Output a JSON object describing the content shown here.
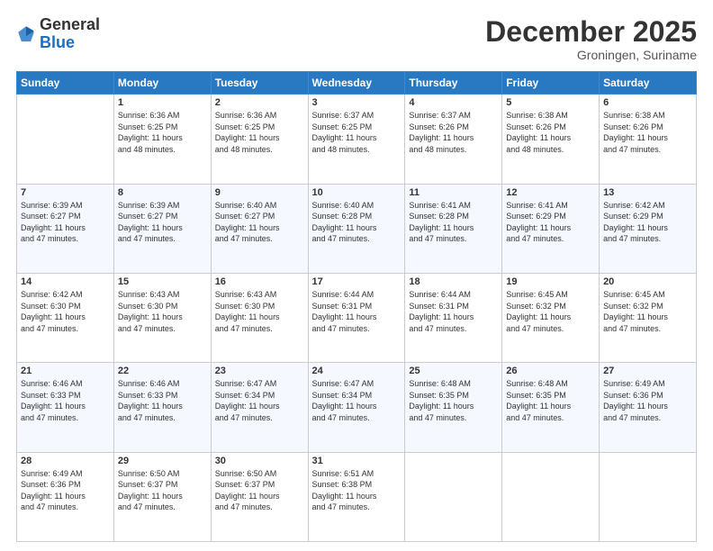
{
  "header": {
    "logo_general": "General",
    "logo_blue": "Blue",
    "month": "December 2025",
    "location": "Groningen, Suriname"
  },
  "weekdays": [
    "Sunday",
    "Monday",
    "Tuesday",
    "Wednesday",
    "Thursday",
    "Friday",
    "Saturday"
  ],
  "weeks": [
    [
      {
        "day": "",
        "info": ""
      },
      {
        "day": "1",
        "info": "Sunrise: 6:36 AM\nSunset: 6:25 PM\nDaylight: 11 hours\nand 48 minutes."
      },
      {
        "day": "2",
        "info": "Sunrise: 6:36 AM\nSunset: 6:25 PM\nDaylight: 11 hours\nand 48 minutes."
      },
      {
        "day": "3",
        "info": "Sunrise: 6:37 AM\nSunset: 6:25 PM\nDaylight: 11 hours\nand 48 minutes."
      },
      {
        "day": "4",
        "info": "Sunrise: 6:37 AM\nSunset: 6:26 PM\nDaylight: 11 hours\nand 48 minutes."
      },
      {
        "day": "5",
        "info": "Sunrise: 6:38 AM\nSunset: 6:26 PM\nDaylight: 11 hours\nand 48 minutes."
      },
      {
        "day": "6",
        "info": "Sunrise: 6:38 AM\nSunset: 6:26 PM\nDaylight: 11 hours\nand 47 minutes."
      }
    ],
    [
      {
        "day": "7",
        "info": "Sunrise: 6:39 AM\nSunset: 6:27 PM\nDaylight: 11 hours\nand 47 minutes."
      },
      {
        "day": "8",
        "info": "Sunrise: 6:39 AM\nSunset: 6:27 PM\nDaylight: 11 hours\nand 47 minutes."
      },
      {
        "day": "9",
        "info": "Sunrise: 6:40 AM\nSunset: 6:27 PM\nDaylight: 11 hours\nand 47 minutes."
      },
      {
        "day": "10",
        "info": "Sunrise: 6:40 AM\nSunset: 6:28 PM\nDaylight: 11 hours\nand 47 minutes."
      },
      {
        "day": "11",
        "info": "Sunrise: 6:41 AM\nSunset: 6:28 PM\nDaylight: 11 hours\nand 47 minutes."
      },
      {
        "day": "12",
        "info": "Sunrise: 6:41 AM\nSunset: 6:29 PM\nDaylight: 11 hours\nand 47 minutes."
      },
      {
        "day": "13",
        "info": "Sunrise: 6:42 AM\nSunset: 6:29 PM\nDaylight: 11 hours\nand 47 minutes."
      }
    ],
    [
      {
        "day": "14",
        "info": "Sunrise: 6:42 AM\nSunset: 6:30 PM\nDaylight: 11 hours\nand 47 minutes."
      },
      {
        "day": "15",
        "info": "Sunrise: 6:43 AM\nSunset: 6:30 PM\nDaylight: 11 hours\nand 47 minutes."
      },
      {
        "day": "16",
        "info": "Sunrise: 6:43 AM\nSunset: 6:30 PM\nDaylight: 11 hours\nand 47 minutes."
      },
      {
        "day": "17",
        "info": "Sunrise: 6:44 AM\nSunset: 6:31 PM\nDaylight: 11 hours\nand 47 minutes."
      },
      {
        "day": "18",
        "info": "Sunrise: 6:44 AM\nSunset: 6:31 PM\nDaylight: 11 hours\nand 47 minutes."
      },
      {
        "day": "19",
        "info": "Sunrise: 6:45 AM\nSunset: 6:32 PM\nDaylight: 11 hours\nand 47 minutes."
      },
      {
        "day": "20",
        "info": "Sunrise: 6:45 AM\nSunset: 6:32 PM\nDaylight: 11 hours\nand 47 minutes."
      }
    ],
    [
      {
        "day": "21",
        "info": "Sunrise: 6:46 AM\nSunset: 6:33 PM\nDaylight: 11 hours\nand 47 minutes."
      },
      {
        "day": "22",
        "info": "Sunrise: 6:46 AM\nSunset: 6:33 PM\nDaylight: 11 hours\nand 47 minutes."
      },
      {
        "day": "23",
        "info": "Sunrise: 6:47 AM\nSunset: 6:34 PM\nDaylight: 11 hours\nand 47 minutes."
      },
      {
        "day": "24",
        "info": "Sunrise: 6:47 AM\nSunset: 6:34 PM\nDaylight: 11 hours\nand 47 minutes."
      },
      {
        "day": "25",
        "info": "Sunrise: 6:48 AM\nSunset: 6:35 PM\nDaylight: 11 hours\nand 47 minutes."
      },
      {
        "day": "26",
        "info": "Sunrise: 6:48 AM\nSunset: 6:35 PM\nDaylight: 11 hours\nand 47 minutes."
      },
      {
        "day": "27",
        "info": "Sunrise: 6:49 AM\nSunset: 6:36 PM\nDaylight: 11 hours\nand 47 minutes."
      }
    ],
    [
      {
        "day": "28",
        "info": "Sunrise: 6:49 AM\nSunset: 6:36 PM\nDaylight: 11 hours\nand 47 minutes."
      },
      {
        "day": "29",
        "info": "Sunrise: 6:50 AM\nSunset: 6:37 PM\nDaylight: 11 hours\nand 47 minutes."
      },
      {
        "day": "30",
        "info": "Sunrise: 6:50 AM\nSunset: 6:37 PM\nDaylight: 11 hours\nand 47 minutes."
      },
      {
        "day": "31",
        "info": "Sunrise: 6:51 AM\nSunset: 6:38 PM\nDaylight: 11 hours\nand 47 minutes."
      },
      {
        "day": "",
        "info": ""
      },
      {
        "day": "",
        "info": ""
      },
      {
        "day": "",
        "info": ""
      }
    ]
  ]
}
